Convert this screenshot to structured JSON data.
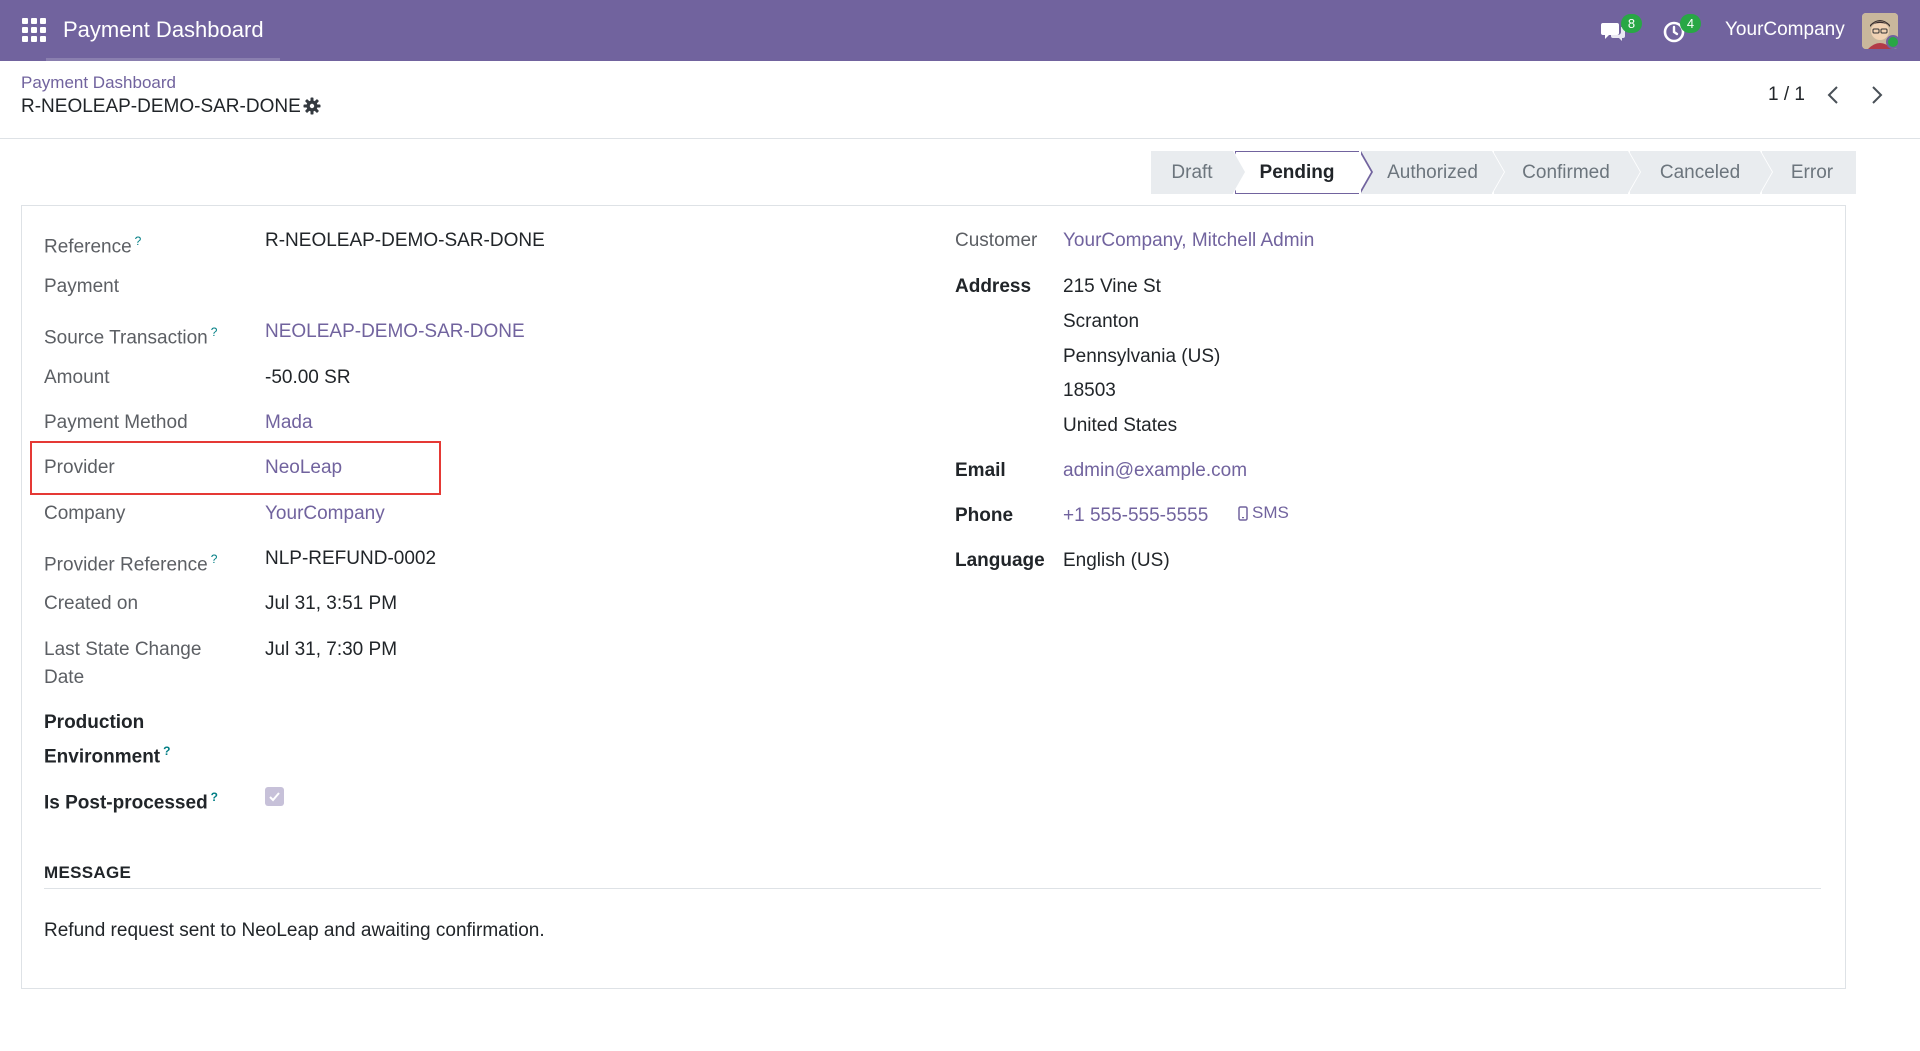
{
  "navbar": {
    "app_title": "Payment Dashboard",
    "messages_count": "8",
    "activities_count": "4",
    "company": "YourCompany"
  },
  "control_panel": {
    "breadcrumb_parent": "Payment Dashboard",
    "record_name": "R-NEOLEAP-DEMO-SAR-DONE",
    "pager": "1 / 1"
  },
  "statusbar": {
    "stages": [
      "Draft",
      "Pending",
      "Authorized",
      "Confirmed",
      "Canceled",
      "Error"
    ],
    "active": "Pending"
  },
  "form": {
    "left": {
      "reference_label": "Reference",
      "reference_value": "R-NEOLEAP-DEMO-SAR-DONE",
      "payment_label": "Payment",
      "source_tx_label": "Source Transaction",
      "source_tx_value": "NEOLEAP-DEMO-SAR-DONE",
      "amount_label": "Amount",
      "amount_value": "-50.00 SR",
      "payment_method_label": "Payment Method",
      "payment_method_value": "Mada",
      "provider_label": "Provider",
      "provider_value": "NeoLeap",
      "company_label": "Company",
      "company_value": "YourCompany",
      "provider_ref_label": "Provider Reference",
      "provider_ref_value": "NLP-REFUND-0002",
      "created_on_label": "Created on",
      "created_on_value": "Jul 31, 3:51 PM",
      "last_state_label_1": "Last State Change",
      "last_state_label_2": "Date",
      "last_state_value": "Jul 31, 7:30 PM",
      "prod_env_label_1": "Production",
      "prod_env_label_2": "Environment",
      "post_processed_label": "Is Post-processed",
      "post_processed_checked": true,
      "help_mark": "?"
    },
    "right": {
      "customer_label": "Customer",
      "customer_value": "YourCompany, Mitchell Admin",
      "address_label": "Address",
      "address_lines": [
        "215 Vine St",
        "Scranton",
        "Pennsylvania (US)",
        "18503",
        "United States"
      ],
      "email_label": "Email",
      "email_value": "admin@example.com",
      "phone_label": "Phone",
      "phone_value": "+1 555-555-5555",
      "sms_label": "SMS",
      "language_label": "Language",
      "language_value": "English (US)"
    },
    "message": {
      "title": "MESSAGE",
      "text": "Refund request sent to NeoLeap and awaiting confirmation."
    }
  },
  "colors": {
    "navbar": "#71639e",
    "link": "#71639e",
    "badge": "#28a745",
    "highlight": "#e53935"
  }
}
